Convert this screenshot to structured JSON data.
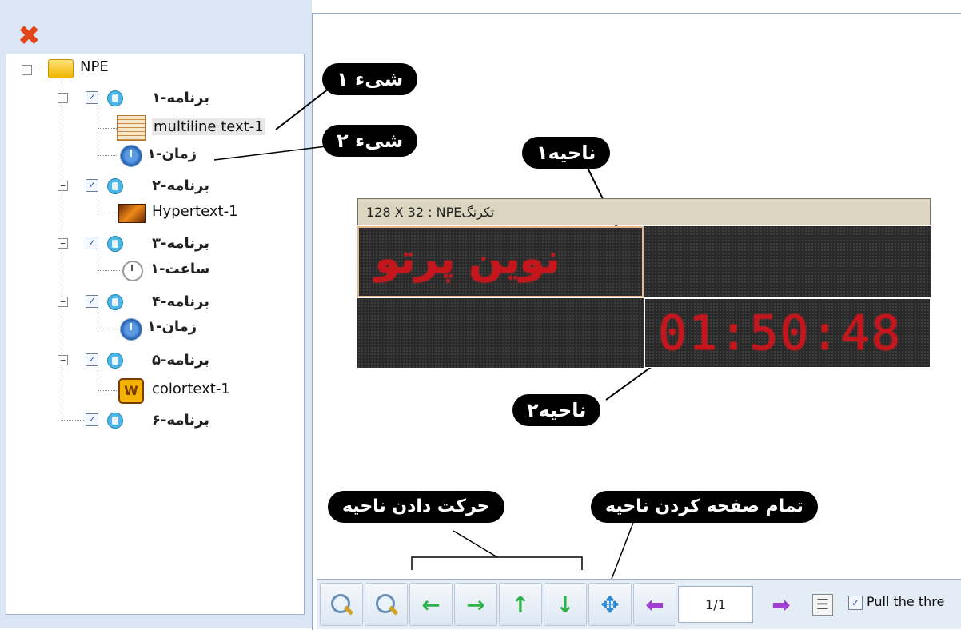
{
  "window": {
    "close_glyph": "✖"
  },
  "tree": {
    "root": {
      "label": "NPE",
      "expander": "−"
    },
    "programs": [
      {
        "label": "برنامه-۱",
        "checked": "✓",
        "children": [
          {
            "label": "multiline text-1",
            "icon": "multiline-text-icon"
          },
          {
            "label": "زمان-۱",
            "icon": "clock-icon"
          }
        ]
      },
      {
        "label": "برنامه-۲",
        "checked": "✓",
        "children": [
          {
            "label": "Hypertext-1",
            "icon": "hypertext-icon"
          }
        ]
      },
      {
        "label": "برنامه-۳",
        "checked": "✓",
        "children": [
          {
            "label": "ساعت-۱",
            "icon": "analog-clock-icon"
          }
        ]
      },
      {
        "label": "برنامه-۴",
        "checked": "✓",
        "children": [
          {
            "label": "زمان-۱",
            "icon": "clock-icon"
          }
        ]
      },
      {
        "label": "برنامه-۵",
        "checked": "✓",
        "children": [
          {
            "label": "colortext-1",
            "icon": "colortext-icon"
          }
        ]
      },
      {
        "label": "برنامه-۶",
        "checked": "✓",
        "children": []
      }
    ]
  },
  "callouts": {
    "object1": "شیء ۱",
    "object2": "شیء ۲",
    "region1": "ناحیه۱",
    "region2": "ناحیه۲",
    "move_region": "حرکت دادن ناحیه",
    "fullscreen_region": "تمام صفحه کردن ناحیه"
  },
  "display": {
    "header": "128 X 32 : NPEتکرنگ",
    "region1_text": "نوین پرتو",
    "region2_text": "01:50:48"
  },
  "toolbar": {
    "zoom_in": "zoom-in-icon",
    "zoom_out": "zoom-out-icon",
    "move_left": "←",
    "move_right": "→",
    "move_up": "↑",
    "move_down": "↓",
    "fullscreen": "✥",
    "prev_page": "⬅",
    "page_value": "1/1",
    "next_page": "➡",
    "align": "☰",
    "pull_checked": "✓",
    "pull_label": "Pull the thre"
  },
  "colors": {
    "accent_red": "#c4161c",
    "pane_bg": "#dae6f4"
  }
}
